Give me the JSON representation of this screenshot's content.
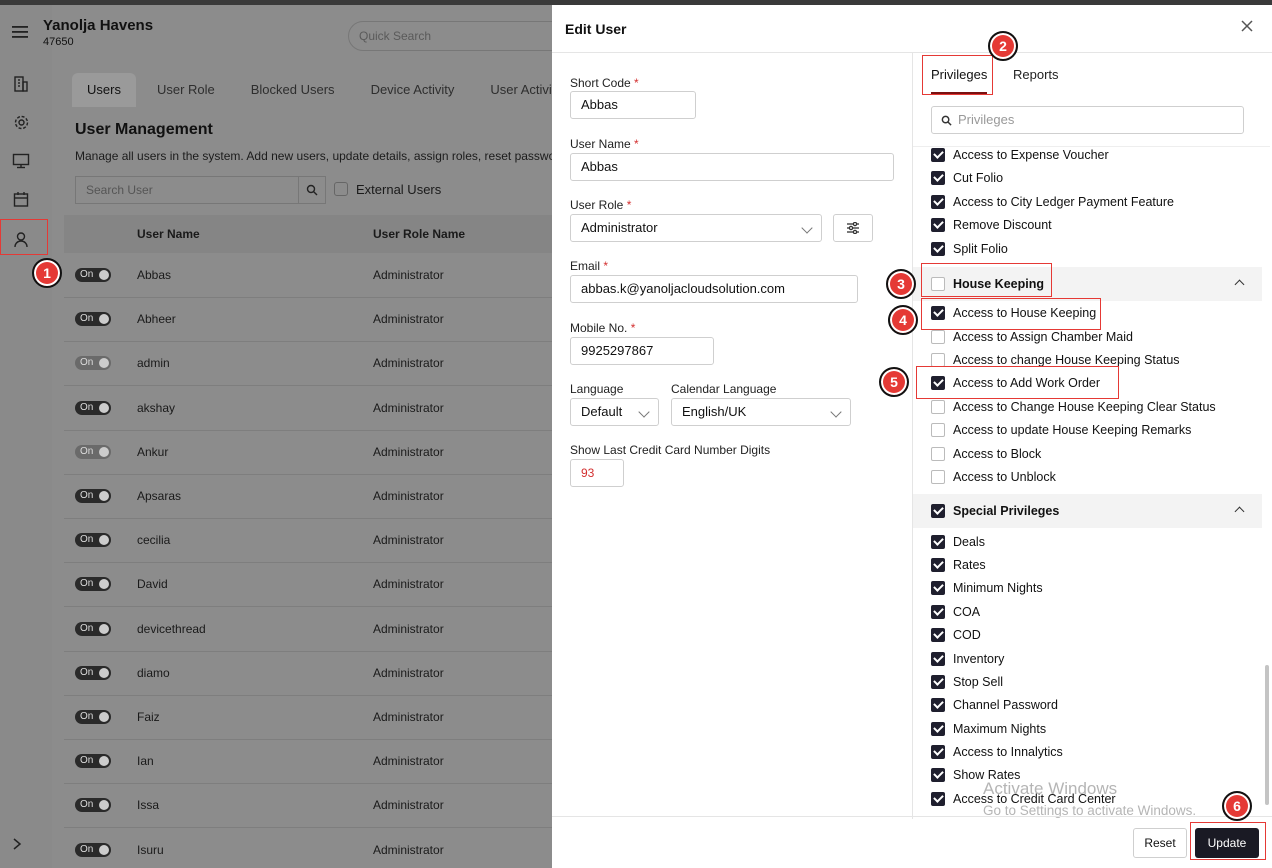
{
  "app": {
    "name": "Yanolja Havens",
    "id": "47650",
    "quick_search_placeholder": "Quick Search"
  },
  "tabs": [
    "Users",
    "User Role",
    "Blocked Users",
    "Device Activity",
    "User Activity"
  ],
  "user_management": {
    "title": "User Management",
    "description": "Manage all users in the system. Add new users, update details, assign roles, reset passwords,",
    "search_placeholder": "Search User",
    "external_users_label": "External Users",
    "columns": [
      "User Name",
      "User Role Name"
    ],
    "toggle_label": "On",
    "rows": [
      {
        "name": "Abbas",
        "role": "Administrator",
        "on": true
      },
      {
        "name": "Abheer",
        "role": "Administrator",
        "on": true
      },
      {
        "name": "admin",
        "role": "Administrator",
        "on": false
      },
      {
        "name": "akshay",
        "role": "Administrator",
        "on": true
      },
      {
        "name": "Ankur",
        "role": "Administrator",
        "on": false
      },
      {
        "name": "Apsaras",
        "role": "Administrator",
        "on": true
      },
      {
        "name": "cecilia",
        "role": "Administrator",
        "on": true
      },
      {
        "name": "David",
        "role": "Administrator",
        "on": true
      },
      {
        "name": "devicethread",
        "role": "Administrator",
        "on": true
      },
      {
        "name": "diamo",
        "role": "Administrator",
        "on": true
      },
      {
        "name": "Faiz",
        "role": "Administrator",
        "on": true
      },
      {
        "name": "Ian",
        "role": "Administrator",
        "on": true
      },
      {
        "name": "Issa",
        "role": "Administrator",
        "on": true
      },
      {
        "name": "Isuru",
        "role": "Administrator",
        "on": true
      }
    ]
  },
  "edit_user": {
    "title": "Edit User",
    "short_code_label": "Short Code",
    "short_code": "Abbas",
    "user_name_label": "User Name",
    "user_name": "Abbas",
    "user_role_label": "User Role",
    "user_role": "Administrator",
    "email_label": "Email",
    "email": "abbas.k@yanoljacloudsolution.com",
    "mobile_label": "Mobile No.",
    "mobile": "9925297867",
    "language_label": "Language",
    "language": "Default",
    "calendar_language_label": "Calendar Language",
    "calendar_language": "English/UK",
    "cc_digits_label": "Show Last Credit Card Number Digits",
    "cc_digits": "93",
    "required_mark": "*",
    "reset_label": "Reset",
    "update_label": "Update"
  },
  "privileges_panel": {
    "tabs": [
      "Privileges",
      "Reports"
    ],
    "search_placeholder": "Privileges",
    "top_items": [
      {
        "label": "Access to Expense Voucher",
        "checked": true
      },
      {
        "label": "Cut Folio",
        "checked": true
      },
      {
        "label": "Access to City Ledger Payment Feature",
        "checked": true
      },
      {
        "label": "Remove Discount",
        "checked": true
      },
      {
        "label": "Split Folio",
        "checked": true
      }
    ],
    "house_keeping": {
      "title": "House Keeping",
      "checked": false,
      "items": [
        {
          "label": "Access to House Keeping",
          "checked": true
        },
        {
          "label": "Access to Assign Chamber Maid",
          "checked": false
        },
        {
          "label": "Access to change House Keeping Status",
          "checked": false
        },
        {
          "label": "Access to Add Work Order",
          "checked": true
        },
        {
          "label": "Access to Change House Keeping Clear Status",
          "checked": false
        },
        {
          "label": "Access to update House Keeping Remarks",
          "checked": false
        },
        {
          "label": "Access to Block",
          "checked": false
        },
        {
          "label": "Access to Unblock",
          "checked": false
        }
      ]
    },
    "special_privileges": {
      "title": "Special Privileges",
      "checked": true,
      "items": [
        {
          "label": "Deals",
          "checked": true
        },
        {
          "label": "Rates",
          "checked": true
        },
        {
          "label": "Minimum Nights",
          "checked": true
        },
        {
          "label": "COA",
          "checked": true
        },
        {
          "label": "COD",
          "checked": true
        },
        {
          "label": "Inventory",
          "checked": true
        },
        {
          "label": "Stop Sell",
          "checked": true
        },
        {
          "label": "Channel Password",
          "checked": true
        },
        {
          "label": "Maximum Nights",
          "checked": true
        },
        {
          "label": "Access to Innalytics",
          "checked": true
        },
        {
          "label": "Show Rates",
          "checked": true
        },
        {
          "label": "Access to Credit Card Center",
          "checked": true
        }
      ]
    }
  },
  "watermark": {
    "line1": "Activate Windows",
    "line2": "Go to Settings to activate Windows."
  },
  "annotations": [
    "1",
    "2",
    "3",
    "4",
    "5",
    "6"
  ],
  "colors": {
    "accent": "#e53935",
    "primary_button": "#1a1a24"
  }
}
